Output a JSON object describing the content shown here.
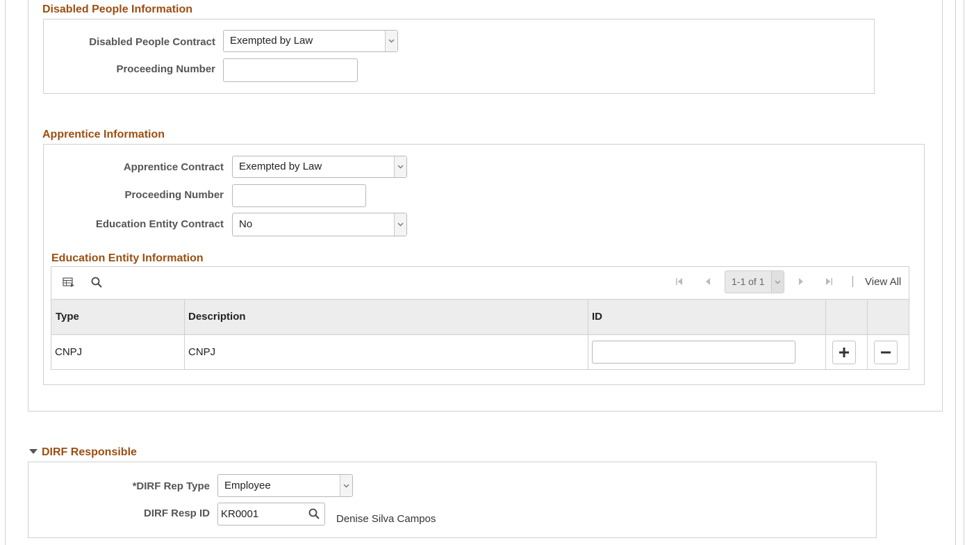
{
  "disabled_people": {
    "title": "Disabled People Information",
    "contract_label": "Disabled People Contract",
    "contract_value": "Exempted by Law",
    "proceeding_label": "Proceeding Number",
    "proceeding_value": ""
  },
  "apprentice": {
    "title": "Apprentice Information",
    "contract_label": "Apprentice Contract",
    "contract_value": "Exempted by Law",
    "proceeding_label": "Proceeding Number",
    "proceeding_value": "",
    "education_contract_label": "Education Entity Contract",
    "education_contract_value": "No"
  },
  "education_entity": {
    "title": "Education Entity Information",
    "pagination": "1-1 of 1",
    "view_all": "View All",
    "columns": [
      "Type",
      "Description",
      "ID"
    ],
    "rows": [
      {
        "type": "CNPJ",
        "description": "CNPJ",
        "id": ""
      }
    ]
  },
  "dirf": {
    "title": "DIRF Responsible",
    "rep_type_label": "*DIRF Rep Type",
    "rep_type_value": "Employee",
    "resp_id_label": "DIRF Resp ID",
    "resp_id_value": "KR0001",
    "resp_name": "Denise Silva Campos"
  },
  "colors": {
    "section_title": "#9c4e12",
    "border": "#cfcfcf",
    "grid_header": "#ededed"
  }
}
